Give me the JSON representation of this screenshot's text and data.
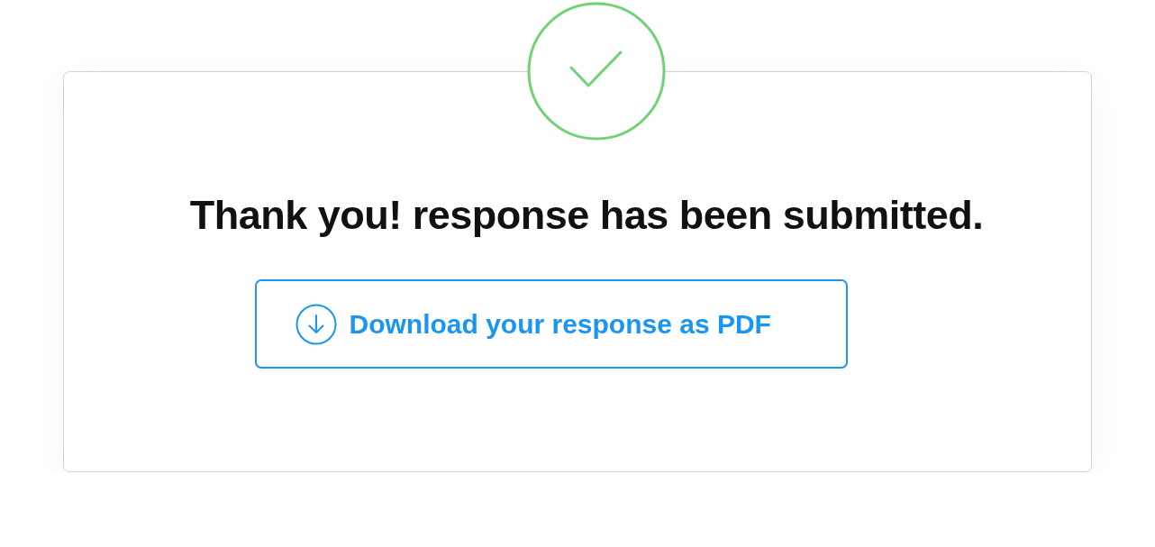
{
  "heading": "Thank you! response has been submitted.",
  "download_button": {
    "label": "Download your response as PDF"
  }
}
